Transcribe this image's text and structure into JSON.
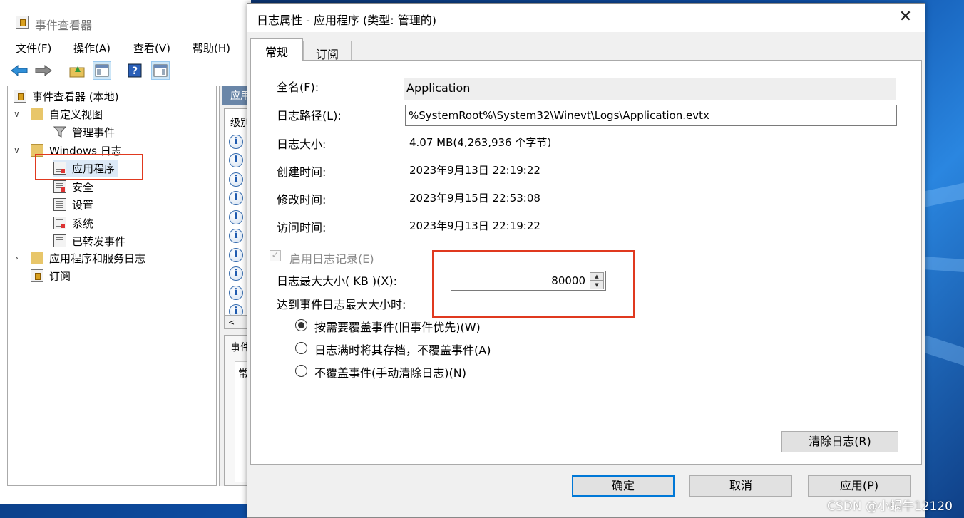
{
  "event_viewer": {
    "title": "事件查看器",
    "menu": [
      "文件(F)",
      "操作(A)",
      "查看(V)",
      "帮助(H)"
    ],
    "tree": {
      "root": "事件查看器 (本地)",
      "custom_views": "自定义视图",
      "admin_events": "管理事件",
      "windows_logs": "Windows 日志",
      "application": "应用程序",
      "security": "安全",
      "setup": "设置",
      "system": "系统",
      "forwarded": "已转发事件",
      "app_service_logs": "应用程序和服务日志",
      "subscriptions": "订阅"
    },
    "middle": {
      "header": "应用",
      "column": "级别",
      "lower_header": "事件",
      "lower_tab": "常"
    }
  },
  "dialog": {
    "title": "日志属性 - 应用程序 (类型: 管理的)",
    "tabs": [
      "常规",
      "订阅"
    ],
    "full_name_label": "全名(F):",
    "full_name": "Application",
    "log_path_label": "日志路径(L):",
    "log_path": "%SystemRoot%\\System32\\Winevt\\Logs\\Application.evtx",
    "log_size_label": "日志大小:",
    "log_size": "4.07 MB(4,263,936 个字节)",
    "created_label": "创建时间:",
    "created": "2023年9月13日 22:19:22",
    "modified_label": "修改时间:",
    "modified": "2023年9月15日 22:53:08",
    "accessed_label": "访问时间:",
    "accessed": "2023年9月13日 22:19:22",
    "enable_logging_label": "启用日志记录(E)",
    "enable_logging_checked": true,
    "max_size_label": "日志最大大小( KB )(X):",
    "max_size_value": "80000",
    "when_max_label": "达到事件日志最大大小时:",
    "options": [
      {
        "label": "按需要覆盖事件(旧事件优先)(W)",
        "selected": true
      },
      {
        "label": "日志满时将其存档，不覆盖事件(A)",
        "selected": false
      },
      {
        "label": "不覆盖事件(手动清除日志)(N)",
        "selected": false
      }
    ],
    "clear_button": "清除日志(R)",
    "ok_button": "确定",
    "cancel_button": "取消",
    "apply_button": "应用(P)"
  },
  "watermark": "CSDN @小蜗牛12120",
  "colors": {
    "highlight": "#e0391f",
    "accent": "#0078d7"
  }
}
